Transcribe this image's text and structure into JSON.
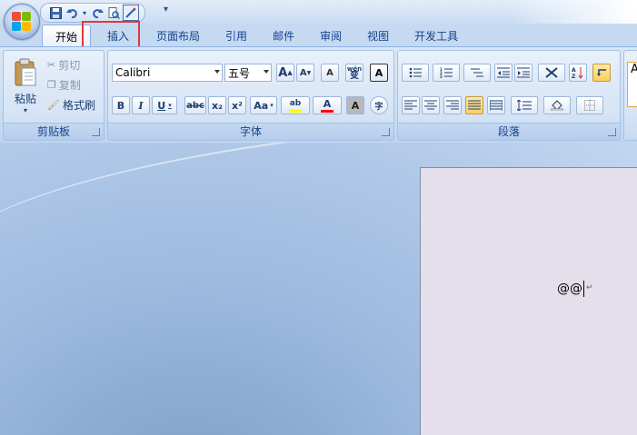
{
  "quick_access": {
    "icons": [
      "save-icon",
      "undo-icon",
      "redo-icon",
      "print-preview-icon",
      "spelling-icon"
    ],
    "more_glyph": "▾"
  },
  "tabs": [
    {
      "label": "开始",
      "active": true
    },
    {
      "label": "插入",
      "active": false
    },
    {
      "label": "页面布局",
      "active": false
    },
    {
      "label": "引用",
      "active": false
    },
    {
      "label": "邮件",
      "active": false
    },
    {
      "label": "审阅",
      "active": false
    },
    {
      "label": "视图",
      "active": false
    },
    {
      "label": "开发工具",
      "active": false
    }
  ],
  "clipboard": {
    "paste_label": "粘贴",
    "cut_label": "剪切",
    "copy_label": "复制",
    "format_painter_label": "格式刷",
    "group_label": "剪贴板"
  },
  "font": {
    "font_name": "Calibri",
    "font_size": "五号",
    "grow_label": "A",
    "shrink_label": "A",
    "clear_label": "A",
    "phonetic_label": "wén",
    "phonetic_char": "变",
    "border_label": "A",
    "bold_label": "B",
    "italic_label": "I",
    "underline_label": "U",
    "strike_label": "abc",
    "sub_label": "x₂",
    "sup_label": "x²",
    "case_label": "Aa",
    "highlight_label": "ab",
    "color_label": "A",
    "shade_label": "A",
    "enclose_label": "字",
    "group_label": "字体"
  },
  "paragraph": {
    "group_label": "段落"
  },
  "style_preview": "A",
  "document": {
    "text": "@@",
    "para_mark": "↵"
  },
  "colors": {
    "highlight": "#ffff00",
    "font_color": "#ff0000",
    "tab_highlight_box": "#e03a3a"
  }
}
